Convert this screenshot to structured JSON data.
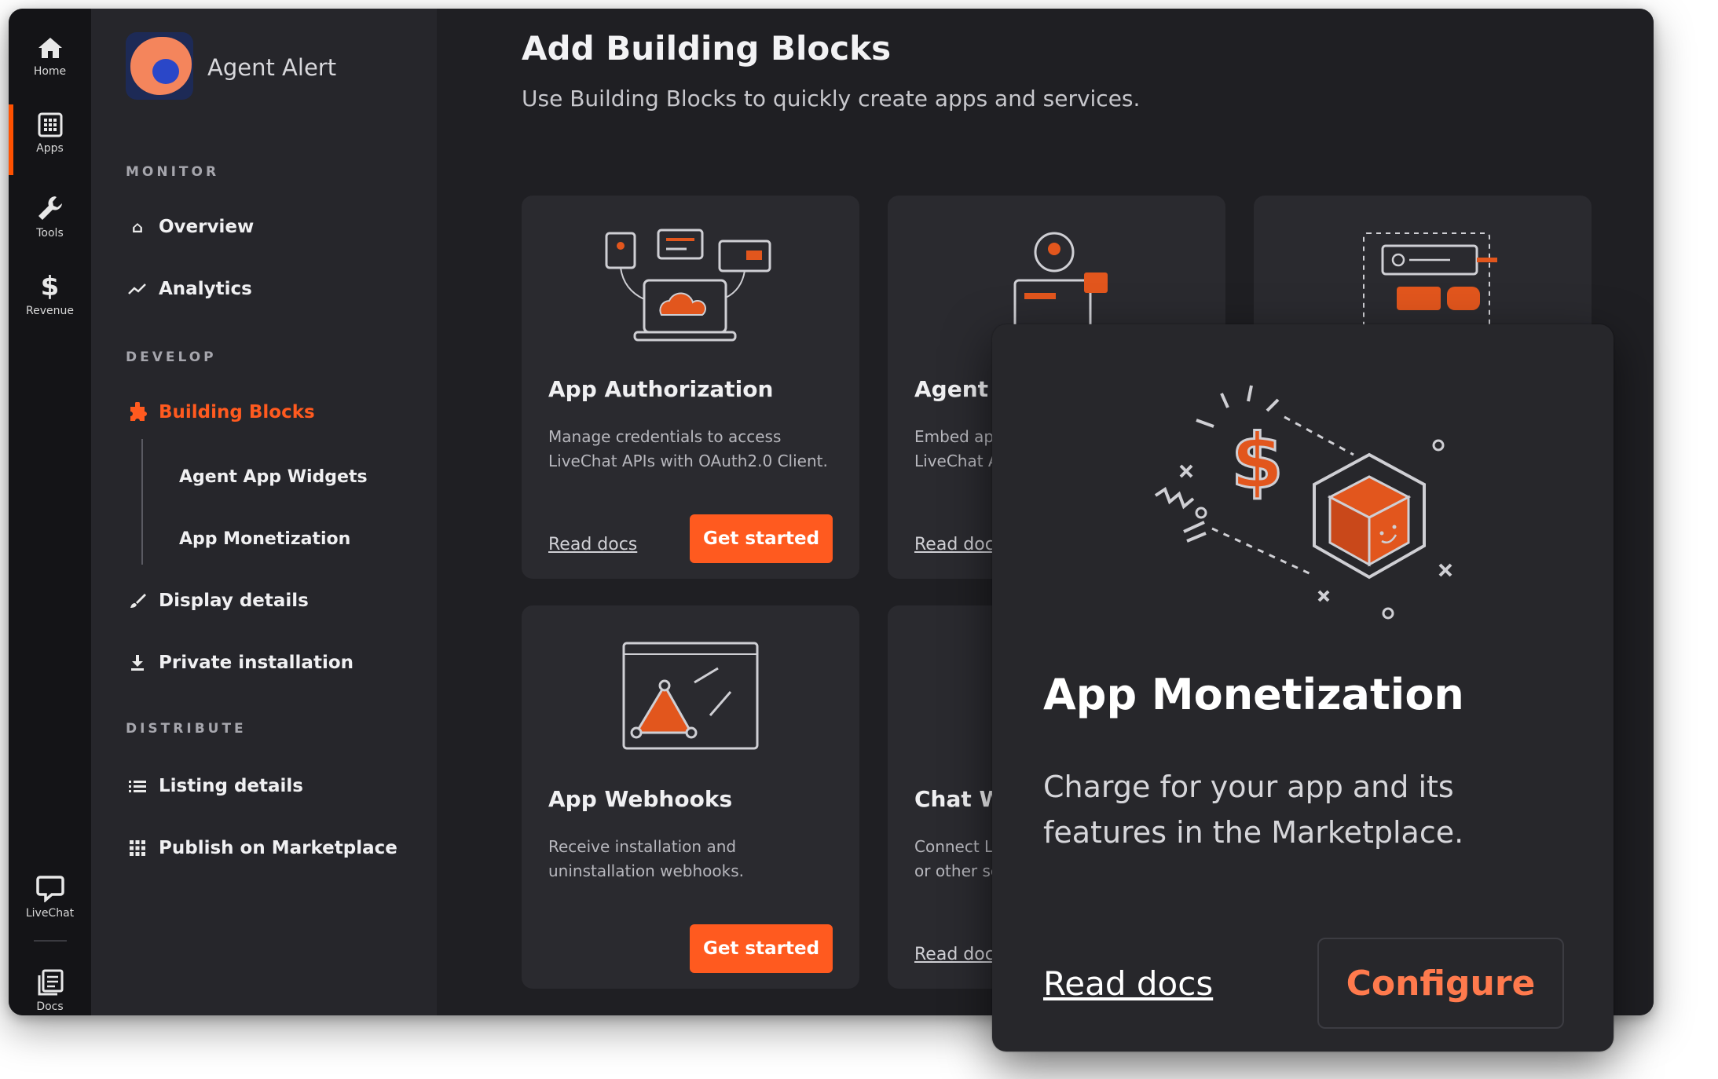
{
  "rail": {
    "items": [
      {
        "label": "Home",
        "icon": "home-icon"
      },
      {
        "label": "Apps",
        "icon": "apps-grid-icon"
      },
      {
        "label": "Tools",
        "icon": "wrench-icon"
      },
      {
        "label": "Revenue",
        "icon": "dollar-icon"
      },
      {
        "label": "LiveChat",
        "icon": "chat-bubble-icon"
      },
      {
        "label": "Docs",
        "icon": "docs-icon"
      }
    ],
    "active": "Apps",
    "glyphs": {
      "revenue": "$"
    }
  },
  "sidebar": {
    "app_name": "Agent Alert",
    "sections": {
      "monitor": "MONITOR",
      "develop": "DEVELOP",
      "distribute": "DISTRIBUTE"
    },
    "items": {
      "overview": "Overview",
      "analytics": "Analytics",
      "building_blocks": "Building Blocks",
      "agent_app_widgets": "Agent App Widgets",
      "app_monetization": "App Monetization",
      "display_details": "Display details",
      "private_installation": "Private installation",
      "listing_details": "Listing details",
      "publish_on_marketplace": "Publish on Marketplace"
    }
  },
  "main": {
    "title": "Add Building Blocks",
    "subtitle": "Use Building Blocks to quickly create apps and services.",
    "cards": [
      {
        "title": "App Authorization",
        "desc": "Manage credentials to access LiveChat APIs with OAuth2.0 Client.",
        "read_docs": "Read docs",
        "cta": "Get started"
      },
      {
        "title": "Agent Ap",
        "desc": "Embed app\nLiveChat A",
        "read_docs": "Read docs"
      },
      {
        "title": "App Webhooks",
        "desc": "Receive installation and uninstallation webhooks.",
        "cta": "Get started"
      },
      {
        "title": "Chat We",
        "desc": "Connect Li\nor other se",
        "read_docs": "Read docs"
      }
    ]
  },
  "popup": {
    "title": "App Monetization",
    "description": "Charge for your app and its features in the Marketplace.",
    "read_docs": "Read docs",
    "configure": "Configure",
    "illustration_glyph": "$"
  },
  "colors": {
    "accent": "#ff5a1f",
    "rail_bg": "#141417",
    "sidebar_bg": "#26262b",
    "main_bg": "#1f1f23",
    "card_bg": "#2a2a2f",
    "popup_bg": "#27272b"
  }
}
